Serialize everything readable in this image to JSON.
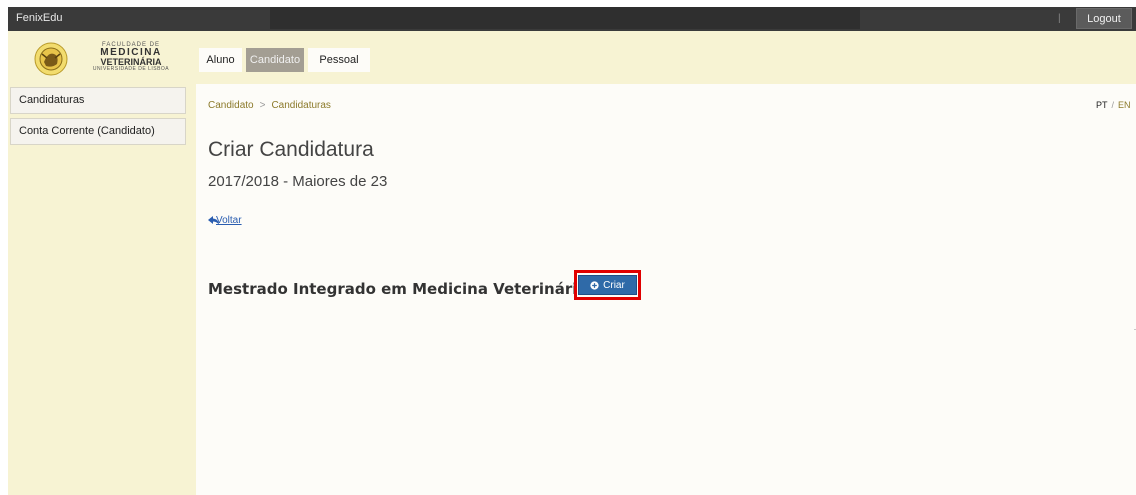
{
  "topbar": {
    "brand": "FenixEdu",
    "logout_label": "Logout"
  },
  "logo": {
    "line1": "FACULDADE DE",
    "line2": "MEDICINA",
    "line3": "VETERINÁRIA",
    "line4": "UNIVERSIDADE DE LISBOA"
  },
  "sidebar": {
    "items": [
      {
        "label": "Candidaturas"
      },
      {
        "label": "Conta Corrente (Candidato)"
      }
    ]
  },
  "tabs": [
    {
      "label": "Aluno",
      "active": false
    },
    {
      "label": "Candidato",
      "active": true
    },
    {
      "label": "Pessoal",
      "active": false
    }
  ],
  "breadcrumb": {
    "items": [
      "Candidato",
      "Candidaturas"
    ],
    "separator": ">"
  },
  "language": {
    "current": "PT",
    "separator": "/",
    "other": "EN"
  },
  "main": {
    "title": "Criar Candidatura",
    "subtitle": "2017/2018 - Maiores de 23",
    "back_label": "Voltar",
    "course_name": "Mestrado Integrado em Medicina Veterinária",
    "create_label": "Criar"
  },
  "icons": {
    "back": "reply-arrow-icon",
    "create": "plus-circle-icon",
    "logo": "faculty-seal-icon"
  },
  "colors": {
    "topbar": "#3a3a3a",
    "sidebar": "#f7f3d3",
    "active_tab": "#a39e93",
    "link": "#8c7a2a",
    "primary_button": "#2f6aa8",
    "highlight": "#e00000"
  }
}
